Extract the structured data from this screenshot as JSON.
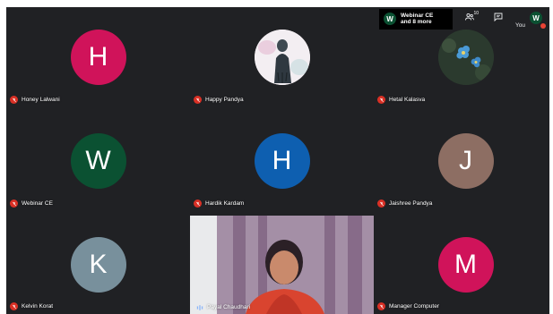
{
  "topbar": {
    "pinned_chip": {
      "avatar_initial": "W",
      "line1": "Webinar CE",
      "line2": "and 8 more"
    },
    "people_count": "10",
    "people_icon": "people-icon",
    "chat_icon": "chat-icon",
    "you_label": "You",
    "you_initial": "W"
  },
  "participants": [
    {
      "name": "Honey Lalwani",
      "initial": "H",
      "color": "#d0135a",
      "muted": true
    },
    {
      "name": "Happy Pandya",
      "initial": "",
      "color": "#f1edf1",
      "muted": true,
      "photo": "portrait-drawing"
    },
    {
      "name": "Hetal Kalasva",
      "initial": "",
      "color": "#2a3a2c",
      "muted": true,
      "photo": "blue-flowers"
    },
    {
      "name": "Webinar CE",
      "initial": "W",
      "color": "#0b5132",
      "muted": true
    },
    {
      "name": "Hardik Kardam",
      "initial": "H",
      "color": "#0e5fb0",
      "muted": true
    },
    {
      "name": "Jaishree Pandya",
      "initial": "J",
      "color": "#8d6e63",
      "muted": true
    },
    {
      "name": "Kelvin Korat",
      "initial": "K",
      "color": "#78909c",
      "muted": true
    },
    {
      "name": "Payal Chaudhari",
      "initial": "",
      "color": "",
      "muted": false,
      "speaking": true,
      "video": true
    },
    {
      "name": "Manager Computer",
      "initial": "M",
      "color": "#d0135a",
      "muted": true
    }
  ]
}
